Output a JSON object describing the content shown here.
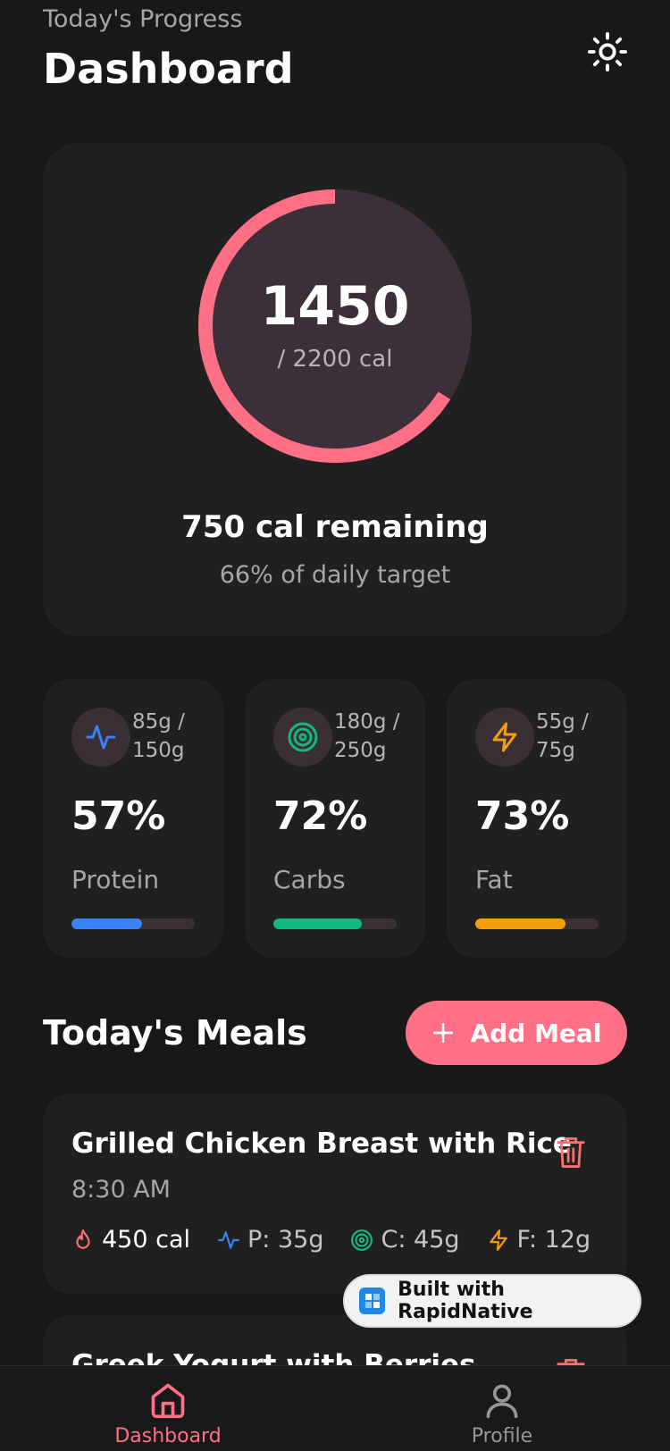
{
  "header": {
    "subtitle": "Today's Progress",
    "title": "Dashboard",
    "theme_icon": "sun-icon"
  },
  "calories": {
    "consumed": "1450",
    "goal_text": "/ 2200 cal",
    "progress": 0.66,
    "remaining_text": "750 cal remaining",
    "percent_text": "66% of daily target",
    "ring_color": "#ff6f85"
  },
  "macros": [
    {
      "name": "Protein",
      "amount": "85g / 150g",
      "percent": "57%",
      "fraction": 0.57,
      "color": "#3b82f6",
      "icon": "pulse-icon"
    },
    {
      "name": "Carbs",
      "amount": "180g / 250g",
      "percent": "72%",
      "fraction": 0.72,
      "color": "#10b981",
      "icon": "target-icon"
    },
    {
      "name": "Fat",
      "amount": "55g / 75g",
      "percent": "73%",
      "fraction": 0.73,
      "color": "#f59e0b",
      "icon": "bolt-icon"
    }
  ],
  "meals_section": {
    "title": "Today's Meals",
    "add_label": "Add Meal"
  },
  "meals": [
    {
      "name": "Grilled Chicken Breast with Rice",
      "time": "8:30 AM",
      "calories": "450 cal",
      "protein": "P: 35g",
      "carbs": "C: 45g",
      "fat": "F: 12g"
    },
    {
      "name": "Greek Yogurt with Berries"
    }
  ],
  "badge": {
    "label": "Built with RapidNative"
  },
  "tabs": [
    {
      "label": "Dashboard",
      "active": true
    },
    {
      "label": "Profile",
      "active": false
    }
  ]
}
